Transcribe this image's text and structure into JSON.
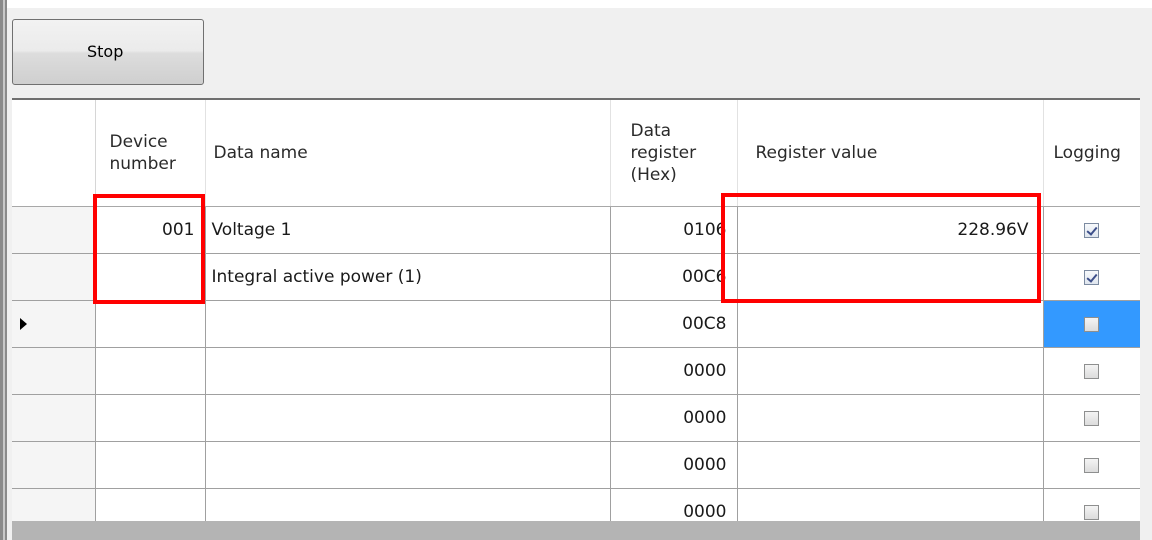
{
  "toolbar": {
    "stop_label": "Stop"
  },
  "table": {
    "columns": {
      "device_number": "Device\nnumber",
      "data_name": "Data name",
      "data_register": "Data\nregister\n(Hex)",
      "register_value": "Register value",
      "logging": "Logging"
    },
    "rows": [
      {
        "device_number": "001",
        "data_name": "Voltage 1",
        "data_register": "0106",
        "register_value": "228.96V",
        "logging": true
      },
      {
        "device_number": "",
        "data_name": "Integral active power (1)",
        "data_register": "00C6",
        "register_value": "",
        "logging": true
      },
      {
        "device_number": "",
        "data_name": "",
        "data_register": "00C8",
        "register_value": "",
        "logging": false,
        "current": true
      },
      {
        "device_number": "",
        "data_name": "",
        "data_register": "0000",
        "register_value": "",
        "logging": false
      },
      {
        "device_number": "",
        "data_name": "",
        "data_register": "0000",
        "register_value": "",
        "logging": false
      },
      {
        "device_number": "",
        "data_name": "",
        "data_register": "0000",
        "register_value": "",
        "logging": false
      },
      {
        "device_number": "",
        "data_name": "",
        "data_register": "0000",
        "register_value": "",
        "logging": false
      }
    ]
  },
  "colors": {
    "highlight": "#ff0000",
    "selection": "#3399ff"
  }
}
